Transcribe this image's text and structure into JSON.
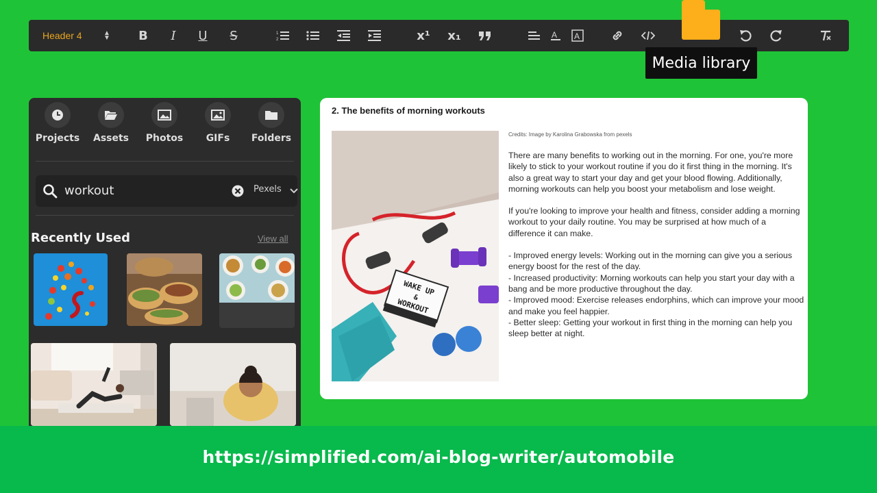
{
  "toolbar": {
    "header_select": "Header 4",
    "tools": [
      {
        "label": "B",
        "name": "bold"
      },
      {
        "label": "I",
        "name": "italic"
      },
      {
        "label": "U",
        "name": "underline"
      },
      {
        "label": "S",
        "name": "strikethrough"
      },
      {
        "label": "x¹",
        "name": "superscript"
      },
      {
        "label": "x₁",
        "name": "subscript"
      }
    ]
  },
  "tooltip": "Media library",
  "panel": {
    "nav": [
      {
        "label": "Projects",
        "icon": "clock-icon"
      },
      {
        "label": "Assets",
        "icon": "folder-open-icon"
      },
      {
        "label": "Photos",
        "icon": "image-icon"
      },
      {
        "label": "GIFs",
        "icon": "gif-icon"
      },
      {
        "label": "Folders",
        "icon": "folder-icon"
      }
    ],
    "search_value": "workout",
    "source": "Pexels",
    "recent_title": "Recently Used",
    "view_all": "View all"
  },
  "article": {
    "title": "2. The benefits of morning workouts",
    "credits": "Credits: Image by Karolina Grabowska from pexels",
    "paragraphs": [
      "There are many benefits to working out in the morning. For one, you're more likely to stick to your workout routine if you do it first thing in the morning. It's also a great way to start your day and get your blood flowing. Additionally, morning workouts can help you boost your metabolism and lose weight.",
      "If you're looking to improve your health and fitness, consider adding a morning workout to your daily routine. You may be surprised at how much of a difference it can make."
    ],
    "bullets": [
      "- Improved energy levels: Working out in the morning can give you a serious energy boost for the rest of the day.",
      "- Increased productivity: Morning workouts can help you start your day with a bang and be more productive throughout the day.",
      "- Improved mood: Exercise releases endorphins, which can improve your mood and make you feel happier.",
      "- Better sleep: Getting your workout in first thing in the morning can help you sleep better at night."
    ],
    "photo_sign": [
      "WAKE UP",
      "&",
      "WORKOUT"
    ]
  },
  "footer_url": "https://simplified.com/ai-blog-writer/automobile",
  "colors": {
    "background": "#1fc337",
    "footer": "#08b94c",
    "toolbar": "#2a2a2a",
    "accent": "#e8a623",
    "folder": "#fdae1b"
  }
}
